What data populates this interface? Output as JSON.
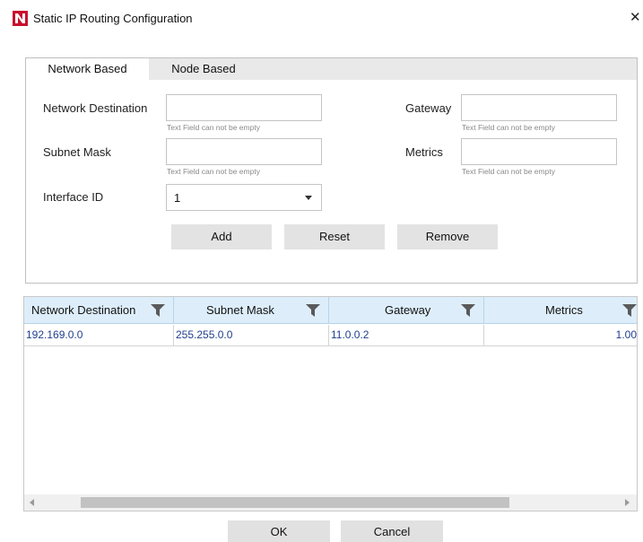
{
  "window": {
    "title": "Static IP Routing Configuration",
    "close_glyph": "✕",
    "logo_icon": "app-logo-icon",
    "logo_color": "#c8102e"
  },
  "tabs": [
    {
      "label": "Network Based",
      "active": true
    },
    {
      "label": "Node Based",
      "active": false
    }
  ],
  "form": {
    "network_destination": {
      "label": "Network Destination",
      "value": "",
      "error": "Text Field can not be empty"
    },
    "gateway": {
      "label": "Gateway",
      "value": "",
      "error": "Text Field can not be empty"
    },
    "subnet_mask": {
      "label": "Subnet Mask",
      "value": "",
      "error": "Text Field can not be empty"
    },
    "metrics": {
      "label": "Metrics",
      "value": "",
      "error": "Text Field can not be empty"
    },
    "interface_id": {
      "label": "Interface ID",
      "value": "1"
    }
  },
  "actions": {
    "add": "Add",
    "reset": "Reset",
    "remove": "Remove"
  },
  "grid": {
    "columns": [
      "Network Destination",
      "Subnet Mask",
      "Gateway",
      "Metrics"
    ],
    "rows": [
      [
        "192.169.0.0",
        "255.255.0.0",
        "11.0.0.2",
        "1.00"
      ]
    ],
    "header_color": "#ddeefa",
    "cell_text_color": "#1f3e8f",
    "filter_icon": "filter-funnel-icon"
  },
  "footer": {
    "ok": "OK",
    "cancel": "Cancel"
  }
}
